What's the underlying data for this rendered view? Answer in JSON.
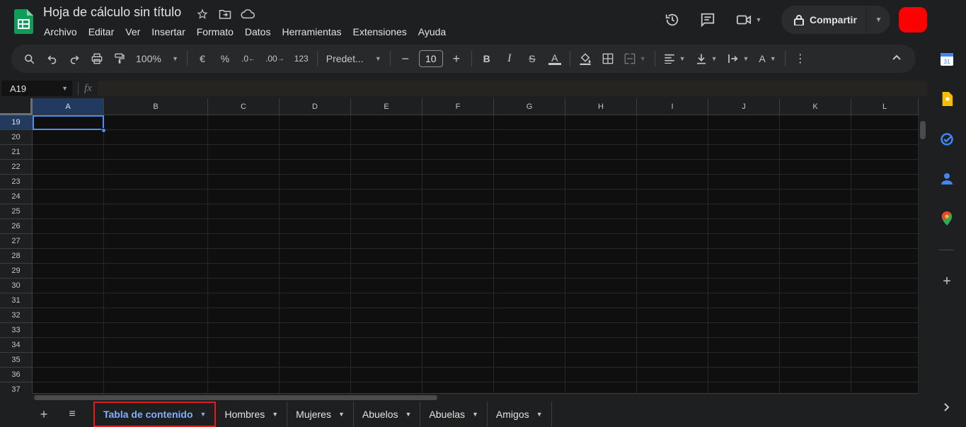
{
  "document": {
    "title": "Hoja de cálculo sin título"
  },
  "menubar": [
    "Archivo",
    "Editar",
    "Ver",
    "Insertar",
    "Formato",
    "Datos",
    "Herramientas",
    "Extensiones",
    "Ayuda"
  ],
  "header": {
    "share_label": "Compartir",
    "avatar_color": "#ff0000"
  },
  "toolbar": {
    "zoom": "100%",
    "currency": "€",
    "percent": "%",
    "decrease_decimals": ".0",
    "increase_decimals": ".00",
    "more_formats": "123",
    "font_family": "Predet...",
    "font_size": "10",
    "bold": "B",
    "italic": "I"
  },
  "formula_bar": {
    "cell_ref": "A19",
    "fx": "fx",
    "value": ""
  },
  "grid": {
    "columns": [
      "A",
      "B",
      "C",
      "D",
      "E",
      "F",
      "G",
      "H",
      "I",
      "J",
      "K",
      "L"
    ],
    "rows": [
      "19",
      "20",
      "21",
      "22",
      "23",
      "24",
      "25",
      "26",
      "27",
      "28",
      "29",
      "30",
      "31",
      "32",
      "33",
      "34",
      "35",
      "36",
      "37"
    ],
    "selected_cell": "A19"
  },
  "sheet_tabs": [
    {
      "label": "Tabla de contenido",
      "active": true
    },
    {
      "label": "Hombres",
      "active": false
    },
    {
      "label": "Mujeres",
      "active": false
    },
    {
      "label": "Abuelos",
      "active": false
    },
    {
      "label": "Abuelas",
      "active": false
    },
    {
      "label": "Amigos",
      "active": false
    }
  ],
  "colors": {
    "accent": "#4c8df6",
    "active_tab": "#7fb0ff",
    "highlight_box": "#e02020",
    "sheets_green": "#0f9d58"
  }
}
